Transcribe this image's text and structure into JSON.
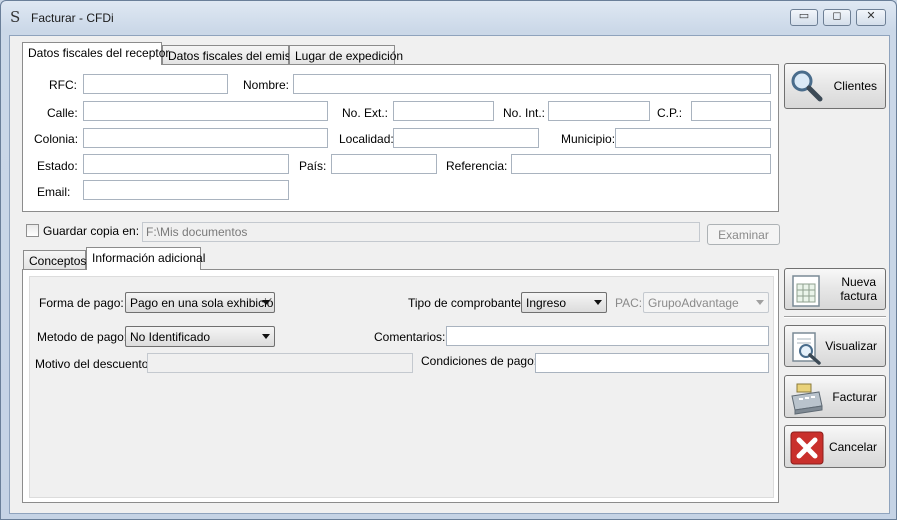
{
  "window": {
    "icon": "S",
    "title": "Facturar - CFDi",
    "min_symbol": "▭",
    "max_symbol": "◻",
    "close_symbol": "✕"
  },
  "top_tabs": [
    "Datos fiscales del receptor",
    "Datos fiscales del emisor",
    "Lugar de expedición"
  ],
  "receptor": {
    "rfc_label": "RFC:",
    "nombre_label": "Nombre:",
    "calle_label": "Calle:",
    "no_ext_label": "No. Ext.:",
    "no_int_label": "No. Int.:",
    "cp_label": "C.P.:",
    "colonia_label": "Colonia:",
    "localidad_label": "Localidad:",
    "municipio_label": "Municipio:",
    "estado_label": "Estado:",
    "pais_label": "País:",
    "referencia_label": "Referencia:",
    "email_label": "Email:"
  },
  "guardar": {
    "label": "Guardar copia en:",
    "path": "F:\\Mis documentos",
    "examinar": "Examinar"
  },
  "bottom_tabs": [
    "Conceptos",
    "Información adicional"
  ],
  "info": {
    "forma_pago_label": "Forma de pago:",
    "forma_pago_value": "Pago en una sola exhibició",
    "tipo_label": "Tipo de comprobante:",
    "tipo_value": "Ingreso",
    "pac_label": "PAC:",
    "pac_value": "GrupoAdvantage",
    "metodo_label": "Metodo de pago:",
    "metodo_value": "No Identificado",
    "comentarios_label": "Comentarios:",
    "motivo_label": "Motivo del descuento:",
    "condiciones_label": "Condiciones de pago:"
  },
  "side_buttons": {
    "clientes": "Clientes",
    "nueva_line1": "Nueva",
    "nueva_line2": "factura",
    "visualizar": "Visualizar",
    "facturar": "Facturar",
    "cancelar": "Cancelar"
  },
  "icons": {
    "clientes": "magnifier-icon",
    "nueva": "spreadsheet-icon",
    "visualizar": "document-preview-icon",
    "facturar": "cash-register-icon",
    "cancelar": "red-x-icon"
  },
  "colors": {
    "title_bg": "#cbd8e8",
    "cancel_red": "#c9302c"
  }
}
